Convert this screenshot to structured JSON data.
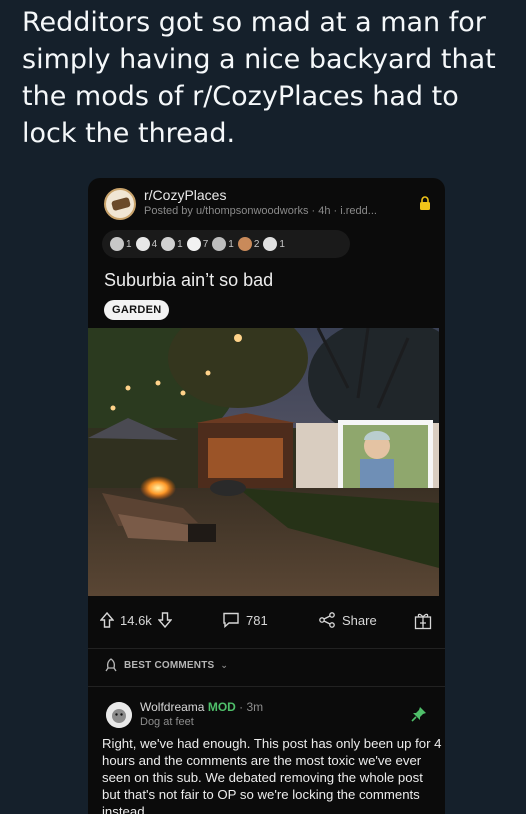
{
  "tweet": {
    "text": "Redditors got so mad at a man for simply having a nice backyard that the mods of r/CozyPlaces had to lock the thread."
  },
  "post": {
    "subreddit": "r/CozyPlaces",
    "meta": "Posted by u/thompsonwoodworks · 4h · i.redd...",
    "awards": [
      "1",
      "4",
      "1",
      "7",
      "1",
      "2",
      "1"
    ],
    "title": "Suburbia ain’t so bad",
    "flair": "GARDEN",
    "upvotes": "14.6k",
    "comments": "781",
    "share_label": "Share"
  },
  "comments_section": {
    "sort_label": "BEST COMMENTS",
    "comment": {
      "author": "Wolfdreama",
      "mod_label": "MOD",
      "time": "· 3m",
      "flair": "Dog at feet",
      "body": "Right, we've had enough. This post has only been up for 4 hours and the comments are the most toxic we've ever seen on this sub. We debated removing the whole post but that's not fair to OP so we're locking the comments instead."
    }
  },
  "colors": {
    "background": "#15202b",
    "card": "#0b0b0b",
    "mod_green": "#4fbf6a",
    "lock_yellow": "#f0c419"
  }
}
